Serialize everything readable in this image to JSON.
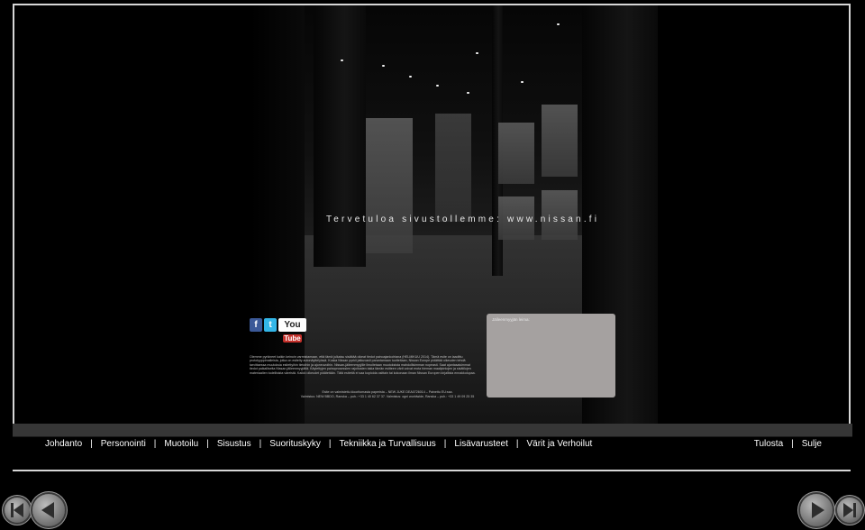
{
  "welcome": "Tervetuloa sivustollemme: www.nissan.fi",
  "social": {
    "facebook": "f",
    "twitter": "t",
    "youtube_you": "You",
    "youtube_tube": "Tube"
  },
  "disclaimer": "Olemme pyrkineet kaikin keinoin varmistamaan, että tämä julkaisu sisältää oikeat tiedot painoajankohtana (HELMIKUU 2014). Tämä esite on laadittu prototyyppimalleista, jotka on esitelty autonäyttelyissä. Koska Nissan pyrkii jatkuvasti parantamaan tuotteitaan, Nissan Europe pidättää oikeuden tehdä tarvittaessa muutoksia esitettyihin tietoihin ja ajoneuvoihin. Nissan-jälleenmyyjille ilmoitetaan muutoksista mahdollisimman nopeasti. Saat ajantasaisimmat tiedot paikalliselta Nissan-jälleenmyyjältä. Käytettyjen painoprosessien rajoitusten takia tämän esitteen värit voivat erota hieman maalipintojen ja sisätilojen materiaalien todellisista väreistä. Kaikki oikeudet pidätetään. Tätä esitettä ei saa kopioida osittain tai kokonaan ilman Nissan Europen kirjallista ennakkolupaa.",
  "credits": {
    "line1": "Esite on valmistettu klooritomasta paperista – NEW JUKE DEA0726014 – Painettu EU:ssa.",
    "line2": "Valmistus: NEW BBDO, Ranska – puh.: +33 1 40 62 37 37. Valmistus: ogni worldwide, Ranska – puh.: +33 1 49 09 25 35"
  },
  "dealer": {
    "label": "Jälleenmyyjän leima:"
  },
  "nav": {
    "items": [
      "Johdanto",
      "Personointi",
      "Muotoilu",
      "Sisustus",
      "Suorituskyky",
      "Tekniikka ja Turvallisuus",
      "Lisävarusteet",
      "Värit ja Verhoilut"
    ],
    "separator": "|",
    "print": "Tulosta",
    "close": "Sulje"
  }
}
